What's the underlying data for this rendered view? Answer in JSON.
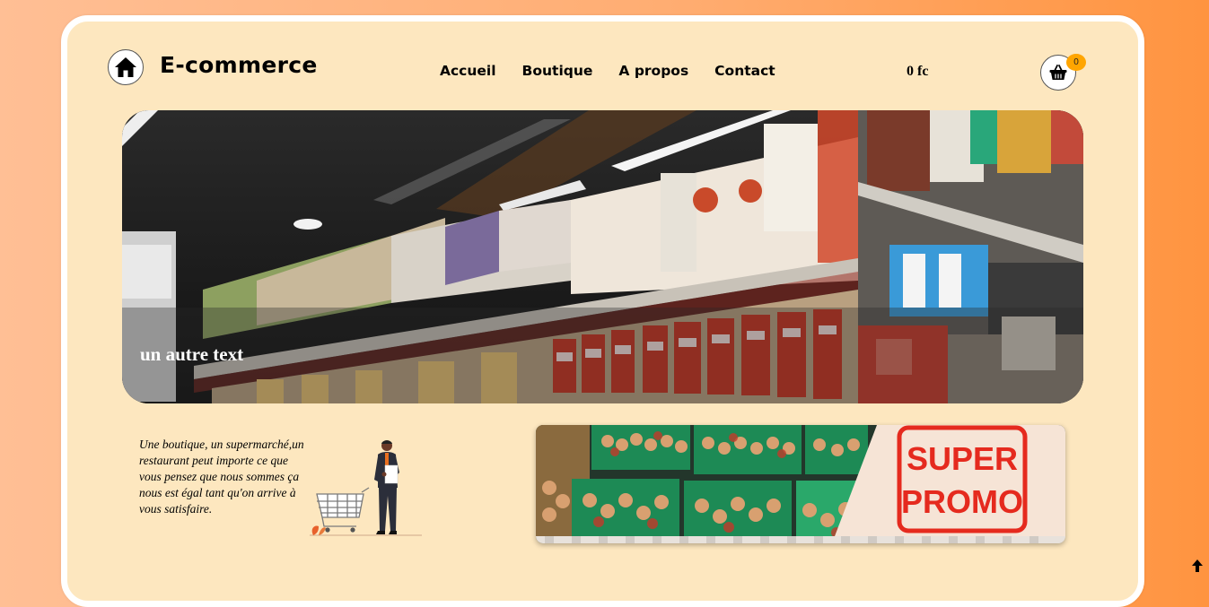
{
  "header": {
    "brand": "E-commerce",
    "nav": [
      "Accueil",
      "Boutique",
      "A propos",
      "Contact"
    ],
    "cart_total": "0 fc",
    "cart_count": "0"
  },
  "hero": {
    "caption": "un autre text"
  },
  "about": {
    "text": "Une boutique, un supermarché,un restaurant peut importe ce que vous pensez que nous sommes ça nous est égal tant qu'on arrive à vous satisfaire."
  },
  "promo": {
    "line1": "SUPER",
    "line2": "PROMO"
  },
  "icons": {
    "logo": "home-icon",
    "cart": "basket-icon",
    "scroll": "arrow-up-icon"
  },
  "colors": {
    "background": "#ffad72",
    "card": "#fde7bf",
    "badge": "#ffa500",
    "promo": "#e52a1e"
  }
}
